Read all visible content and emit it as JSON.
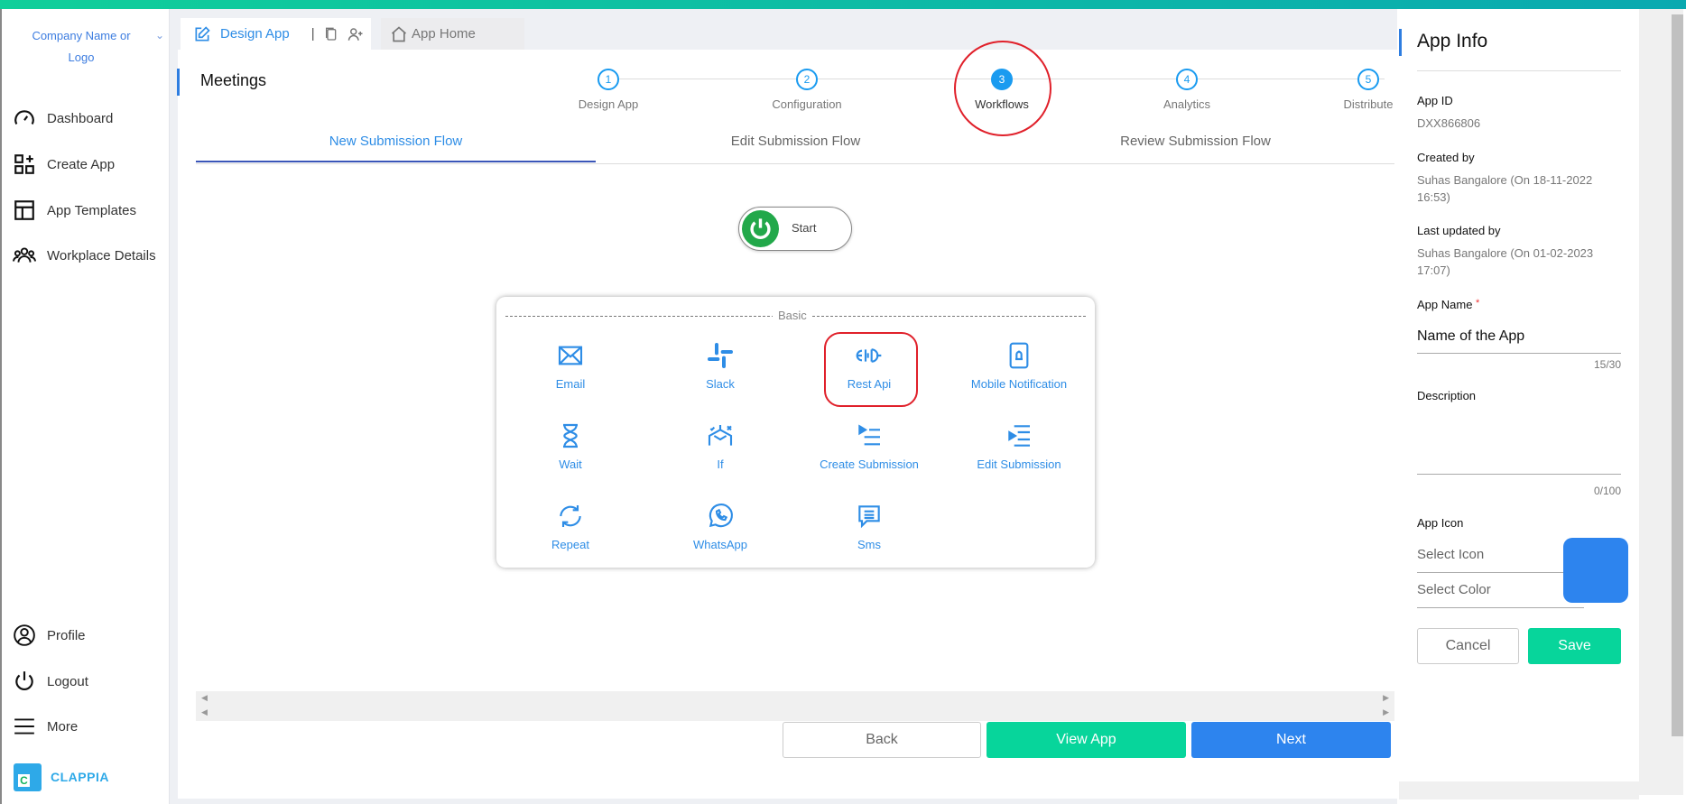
{
  "sidebar": {
    "company": "Company Name or Logo",
    "items": [
      {
        "label": "Dashboard"
      },
      {
        "label": "Create App"
      },
      {
        "label": "App Templates"
      },
      {
        "label": "Workplace Details"
      }
    ],
    "bottom": [
      {
        "label": "Profile"
      },
      {
        "label": "Logout"
      },
      {
        "label": "More"
      }
    ],
    "brand": "CLAPPIA"
  },
  "tabs": {
    "design": "Design App",
    "home": "App Home"
  },
  "page_title": "Meetings",
  "steps": [
    {
      "num": "1",
      "label": "Design App"
    },
    {
      "num": "2",
      "label": "Configuration"
    },
    {
      "num": "3",
      "label": "Workflows"
    },
    {
      "num": "4",
      "label": "Analytics"
    },
    {
      "num": "5",
      "label": "Distribute"
    }
  ],
  "subtabs": [
    "New Submission Flow",
    "Edit Submission Flow",
    "Review Submission Flow"
  ],
  "start_label": "Start",
  "palette": {
    "section": "Basic",
    "nodes": [
      "Email",
      "Slack",
      "Rest Api",
      "Mobile Notification",
      "Wait",
      "If",
      "Create Submission",
      "Edit Submission",
      "Repeat",
      "WhatsApp",
      "Sms"
    ]
  },
  "footer": {
    "back": "Back",
    "view_app": "View App",
    "next": "Next"
  },
  "app_info": {
    "title": "App Info",
    "app_id_label": "App ID",
    "app_id": "DXX866806",
    "created_label": "Created by",
    "created": "Suhas Bangalore (On 18-11-2022 16:53)",
    "updated_label": "Last updated by",
    "updated": "Suhas Bangalore (On 01-02-2023 17:07)",
    "name_label": "App Name",
    "required": "*",
    "name_value": "Name of the App",
    "name_count": "15/30",
    "desc_label": "Description",
    "desc_count": "0/100",
    "icon_label": "App Icon",
    "select_icon": "Select Icon",
    "select_color": "Select Color",
    "icon_color": "#2d84ee",
    "cancel": "Cancel",
    "save": "Save"
  },
  "colors": {
    "accent": "#2d84ee",
    "green": "#07d59b",
    "blue_step": "#1a9bf0"
  }
}
